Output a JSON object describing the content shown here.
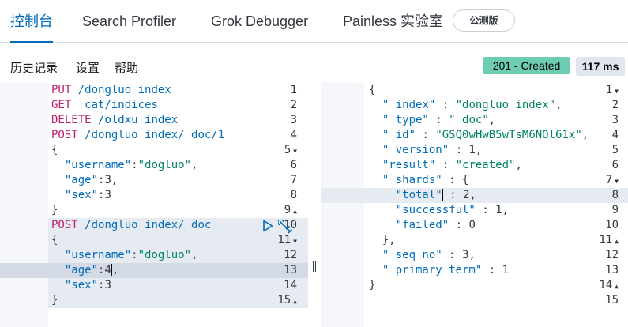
{
  "tabs": [
    {
      "label": "控制台",
      "active": true
    },
    {
      "label": "Search Profiler",
      "active": false
    },
    {
      "label": "Grok Debugger",
      "active": false
    },
    {
      "label": "Painless 实验室",
      "active": false
    }
  ],
  "beta_badge": "公测版",
  "menu": [
    "历史记录",
    "设置",
    "帮助"
  ],
  "status": {
    "text": "201 - Created",
    "color": "#6dccb1"
  },
  "response_time": "117 ms",
  "accent_color": "#006bb8",
  "request_lines": [
    {
      "n": "1",
      "fold": ""
    },
    {
      "n": "2",
      "fold": ""
    },
    {
      "n": "3",
      "fold": ""
    },
    {
      "n": "4",
      "fold": ""
    },
    {
      "n": "5",
      "fold": "▼"
    },
    {
      "n": "6",
      "fold": ""
    },
    {
      "n": "7",
      "fold": ""
    },
    {
      "n": "8",
      "fold": ""
    },
    {
      "n": "9",
      "fold": "▲"
    },
    {
      "n": "10",
      "fold": ""
    },
    {
      "n": "11",
      "fold": "▼"
    },
    {
      "n": "12",
      "fold": ""
    },
    {
      "n": "13",
      "fold": ""
    },
    {
      "n": "14",
      "fold": ""
    },
    {
      "n": "15",
      "fold": "▲"
    }
  ],
  "request_code": {
    "l1_method": "PUT",
    "l1_path": "/dongluo_index",
    "l2_method": "GET",
    "l2_path": "_cat/indices",
    "l3_method": "DELETE",
    "l3_path": "/oldxu_index",
    "l4_method": "POST",
    "l4_path": "/dongluo_index/_doc/1",
    "l5": "{",
    "l6_key": "\"username\"",
    "l6_val": "\"dogluo\"",
    "l7_key": "\"age\"",
    "l7_val": "3",
    "l8_key": "\"sex\"",
    "l8_val": "3",
    "l9": "}",
    "l10_method": "POST",
    "l10_path": "/dongluo_index/_doc",
    "l11": "{",
    "l12_key": "\"username\"",
    "l12_val": "\"dogluo\"",
    "l13_key": "\"age\"",
    "l13_val": "4",
    "l14_key": "\"sex\"",
    "l14_val": "3",
    "l15": "}"
  },
  "response_lines": [
    {
      "n": "1",
      "fold": "▼"
    },
    {
      "n": "2",
      "fold": ""
    },
    {
      "n": "3",
      "fold": ""
    },
    {
      "n": "4",
      "fold": ""
    },
    {
      "n": "5",
      "fold": ""
    },
    {
      "n": "6",
      "fold": ""
    },
    {
      "n": "7",
      "fold": "▼"
    },
    {
      "n": "8",
      "fold": ""
    },
    {
      "n": "9",
      "fold": ""
    },
    {
      "n": "10",
      "fold": ""
    },
    {
      "n": "11",
      "fold": "▲"
    },
    {
      "n": "12",
      "fold": ""
    },
    {
      "n": "13",
      "fold": ""
    },
    {
      "n": "14",
      "fold": "▲"
    },
    {
      "n": "15",
      "fold": ""
    }
  ],
  "response_code": {
    "l1": "{",
    "l2_key": "\"_index\"",
    "l2_val": "\"dongluo_index\"",
    "l3_key": "\"_type\"",
    "l3_val": "\"_doc\"",
    "l4_key": "\"_id\"",
    "l4_val": "\"GSQ0wHwB5wTsM6NOl61x\"",
    "l5_key": "\"_version\"",
    "l5_val": "1",
    "l6_key": "\"result\"",
    "l6_val": "\"created\"",
    "l7_key": "\"_shards\"",
    "l8_key": "\"total\"",
    "l8_val": "2",
    "l9_key": "\"successful\"",
    "l9_val": "1",
    "l10_key": "\"failed\"",
    "l10_val": "0",
    "l11": "},",
    "l12_key": "\"_seq_no\"",
    "l12_val": "3",
    "l13_key": "\"_primary_term\"",
    "l13_val": "1",
    "l14": "}"
  }
}
